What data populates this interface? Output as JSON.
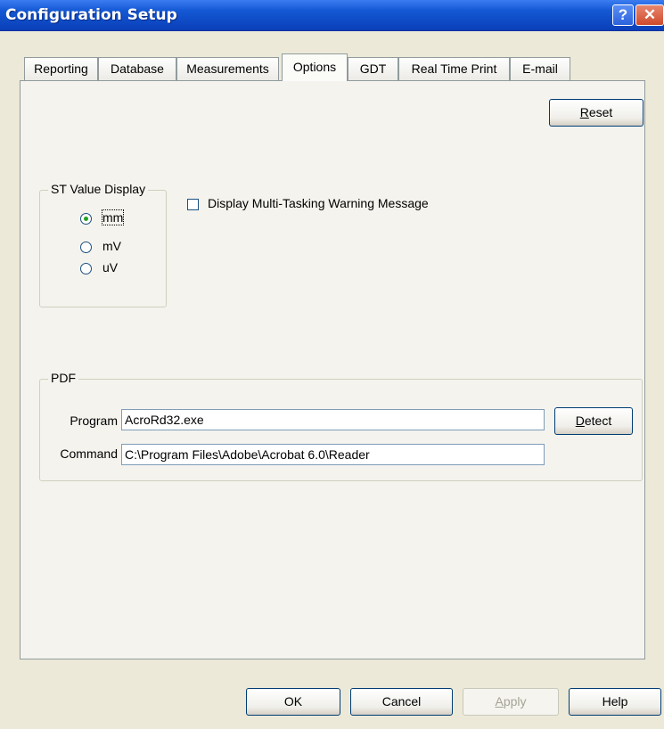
{
  "window": {
    "title": "Configuration Setup",
    "help_glyph": "?",
    "close_glyph": "✕"
  },
  "tabs": [
    {
      "label": "Reporting",
      "active": false
    },
    {
      "label": "Database",
      "active": false
    },
    {
      "label": "Measurements",
      "active": false
    },
    {
      "label": "Options",
      "active": true
    },
    {
      "label": "GDT",
      "active": false
    },
    {
      "label": "Real Time Print",
      "active": false
    },
    {
      "label": "E-mail",
      "active": false
    }
  ],
  "options": {
    "reset_button": {
      "mnemonic": "R",
      "rest": "eset"
    },
    "st_value_display": {
      "legend": "ST Value Display",
      "choices": [
        {
          "label": "mm",
          "checked": true
        },
        {
          "label": "mV",
          "checked": false
        },
        {
          "label": "uV",
          "checked": false
        }
      ]
    },
    "multitask_warning": {
      "label": "Display Multi-Tasking Warning Message",
      "checked": false
    },
    "pdf": {
      "legend": "PDF",
      "program_label": "Program",
      "program_value": "AcroRd32.exe",
      "command_label": "Command",
      "command_value": "C:\\Program Files\\Adobe\\Acrobat 6.0\\Reader",
      "detect_button": {
        "mnemonic": "D",
        "rest": "etect"
      }
    }
  },
  "footer": {
    "ok": "OK",
    "cancel": "Cancel",
    "apply": {
      "mnemonic": "A",
      "rest": "pply",
      "disabled": true
    },
    "help": "Help"
  }
}
